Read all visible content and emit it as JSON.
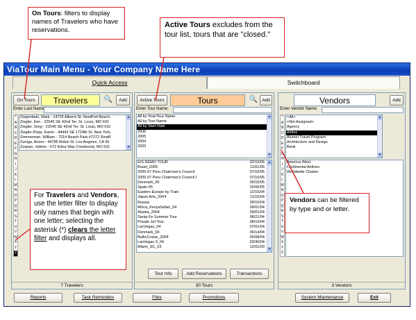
{
  "window": {
    "title": "ViaTour Main Menu - Your Company Name Here",
    "tabs": {
      "quick_access": "Quick Access",
      "switchboard": "Switchboard"
    }
  },
  "travelers": {
    "filter_button": "On Tours",
    "heading": "Travelers",
    "add_button": "Add",
    "search_label": "Enter Last Name:",
    "rows": [
      "Ziegenbein, Mark - 14725 Alberni St. NewPort Beach,",
      "Ziegler, Ken - 22545 SE 42nd Ter. St. Louis, MO 631",
      "Ziegler, Greg - 22545 SE 42nd Ter. St. Louis, MO 631",
      "Ziegler-Popp, Karen - 44442 SE 1724th St. New York,",
      "Zimmerman, William - 7214 Beach Park #7272 StratfI",
      "Zuniga, Arturo - 44785 Robin St. Los Angeles, CA 90",
      "Zuspan, Valerie - 672 Edna Way Crestwood, MO 631"
    ],
    "footer": "7 Travelers"
  },
  "alpha_letters": [
    "*",
    "A",
    "B",
    "C",
    "D",
    "E",
    "F",
    "G",
    "H",
    "I",
    "J",
    "K",
    "L",
    "M",
    "N",
    "O",
    "P",
    "Q",
    "R",
    "S",
    "T",
    "U",
    "V",
    "W",
    "X",
    "Y",
    "Z"
  ],
  "tours": {
    "filter_button": "Active Tours",
    "heading": "Tours",
    "add_button": "Add",
    "search_label": "Enter Tour Name:",
    "filter_options": [
      "All by Year/Tour Name",
      "All by Tour Name",
      "All by Start Date",
      "2006",
      "2005",
      "2004",
      "2003"
    ],
    "rows": [
      {
        "name": "EIS DEMO TOUR",
        "date": "02/10/06"
      },
      {
        "name": "Brazil_2005",
        "date": "11/01/05"
      },
      {
        "name": "2005-07 Peru Chairman's Council",
        "date": "07/16/05"
      },
      {
        "name": "2005-07 Peru Chairman's Council I",
        "date": "07/16/05"
      },
      {
        "name": "Denmark_05",
        "date": "06/15/05"
      },
      {
        "name": "Spain-05",
        "date": "02/05/05"
      },
      {
        "name": "Eastern Europe by Train",
        "date": "12/15/04"
      },
      {
        "name": "Japan Arts_2004",
        "date": "11/15/04"
      },
      {
        "name": "Russia",
        "date": "09/10/04"
      },
      {
        "name": "Africa_KenyaSafari_04",
        "date": "09/01/04"
      },
      {
        "name": "Alaska_2004",
        "date": "09/01/04"
      },
      {
        "name": "Santa Fe Summer Tour",
        "date": "08/21/04"
      },
      {
        "name": "Private Jet Tour",
        "date": "08/10/04"
      },
      {
        "name": "LasVegas_04",
        "date": "07/01/04"
      },
      {
        "name": "Denmark_04",
        "date": "06/14/04"
      },
      {
        "name": "BalticCruise_2004",
        "date": "05/08/04"
      },
      {
        "name": "LasVegas 3_04",
        "date": "03/30/04"
      },
      {
        "name": "Miami_SC_03",
        "date": "12/01/03"
      }
    ],
    "buttons": {
      "info": "Tour Info",
      "reservations": "Add Reservations",
      "transactions": "Transactions"
    },
    "footer": "30 Tours"
  },
  "vendors": {
    "heading": "Vendors",
    "add_button": "Add",
    "search_label": "Enter Vendor Name:",
    "type_options": [
      "<All>",
      "<Not Assigned>",
      "Agency",
      "Airline",
      "Alumni Travel Program",
      "Architecture and Design",
      "Bank"
    ],
    "rows": [
      "America West",
      "Continental Airlines",
      "Worldwide Charter"
    ],
    "footer": "3 Vendors"
  },
  "bottom_buttons": {
    "reports": "Reports",
    "task_reminders": "Task Reminders",
    "files": "Files",
    "promotions": "Promotions",
    "system_maintenance": "System Maintenance",
    "exit": "Exit"
  },
  "callouts": {
    "on_tours_bold": "On Tours",
    "on_tours_text": ": filters to display names of Travelers who have reservations.",
    "active_tours_bold": "Active Tours",
    "active_tours_text": " excludes from the tour list, tours that are \"closed.\"",
    "letters_a": "For ",
    "letters_travelers": "Travelers",
    "letters_and": " and ",
    "letters_vendors": "Vendors",
    "letters_b": ", use the letter filter to display only names that begin with one letter; selecting the asterisk (*) ",
    "letters_clears": "clears",
    "letters_the": " the letter filter",
    "letters_end": " and displays all.",
    "vendors_bold": "Vendors",
    "vendors_text": " can be filtered by type and or letter."
  },
  "colors": {
    "travelers_heading_bg": "#ffff99",
    "tours_heading_bg": "#ffcc99",
    "vendors_heading_bg": "#ffffff",
    "callout_border": "#d42020",
    "titlebar": "#0b3fb5"
  }
}
